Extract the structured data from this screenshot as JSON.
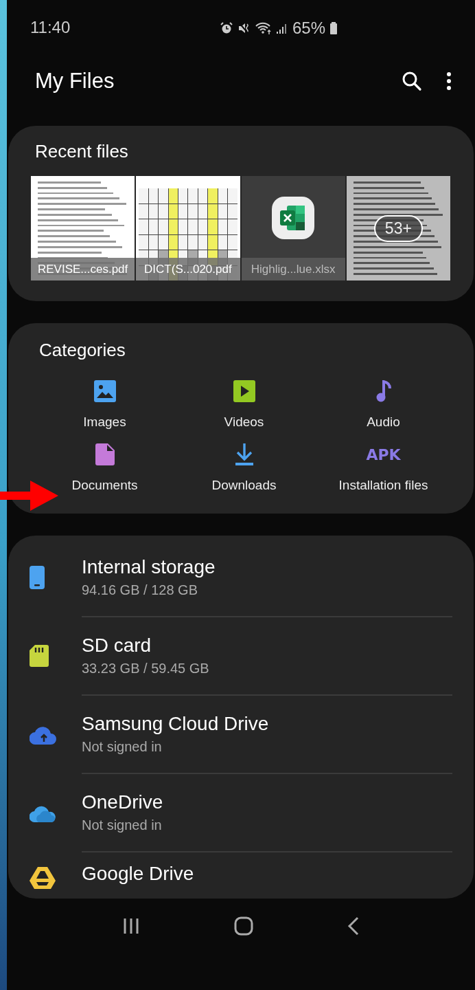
{
  "status_bar": {
    "time": "11:40",
    "battery": "65%"
  },
  "app_bar": {
    "title": "My Files"
  },
  "recent_files": {
    "title": "Recent files",
    "items": [
      {
        "kind": "document",
        "name": "REVISE...ces.pdf"
      },
      {
        "kind": "table",
        "name": "DICT(S...020.pdf"
      },
      {
        "kind": "excel",
        "name": "Highlig...lue.xlsx"
      },
      {
        "kind": "more",
        "count": "53+"
      }
    ]
  },
  "categories": {
    "title": "Categories",
    "items": [
      {
        "kind": "images",
        "label": "Images"
      },
      {
        "kind": "videos",
        "label": "Videos"
      },
      {
        "kind": "audio",
        "label": "Audio"
      },
      {
        "kind": "documents",
        "label": "Documents"
      },
      {
        "kind": "downloads",
        "label": "Downloads"
      },
      {
        "kind": "apk",
        "label": "Installation files",
        "icon_text": "APK"
      }
    ]
  },
  "storage": [
    {
      "kind": "phone",
      "name": "Internal storage",
      "detail": "94.16 GB / 128 GB"
    },
    {
      "kind": "sd",
      "name": "SD card",
      "detail": "33.23 GB / 59.45 GB"
    },
    {
      "kind": "cloud-upload",
      "name": "Samsung Cloud Drive",
      "detail": "Not signed in"
    },
    {
      "kind": "cloud",
      "name": "OneDrive",
      "detail": "Not signed in"
    },
    {
      "kind": "drive",
      "name": "Google Drive"
    }
  ]
}
